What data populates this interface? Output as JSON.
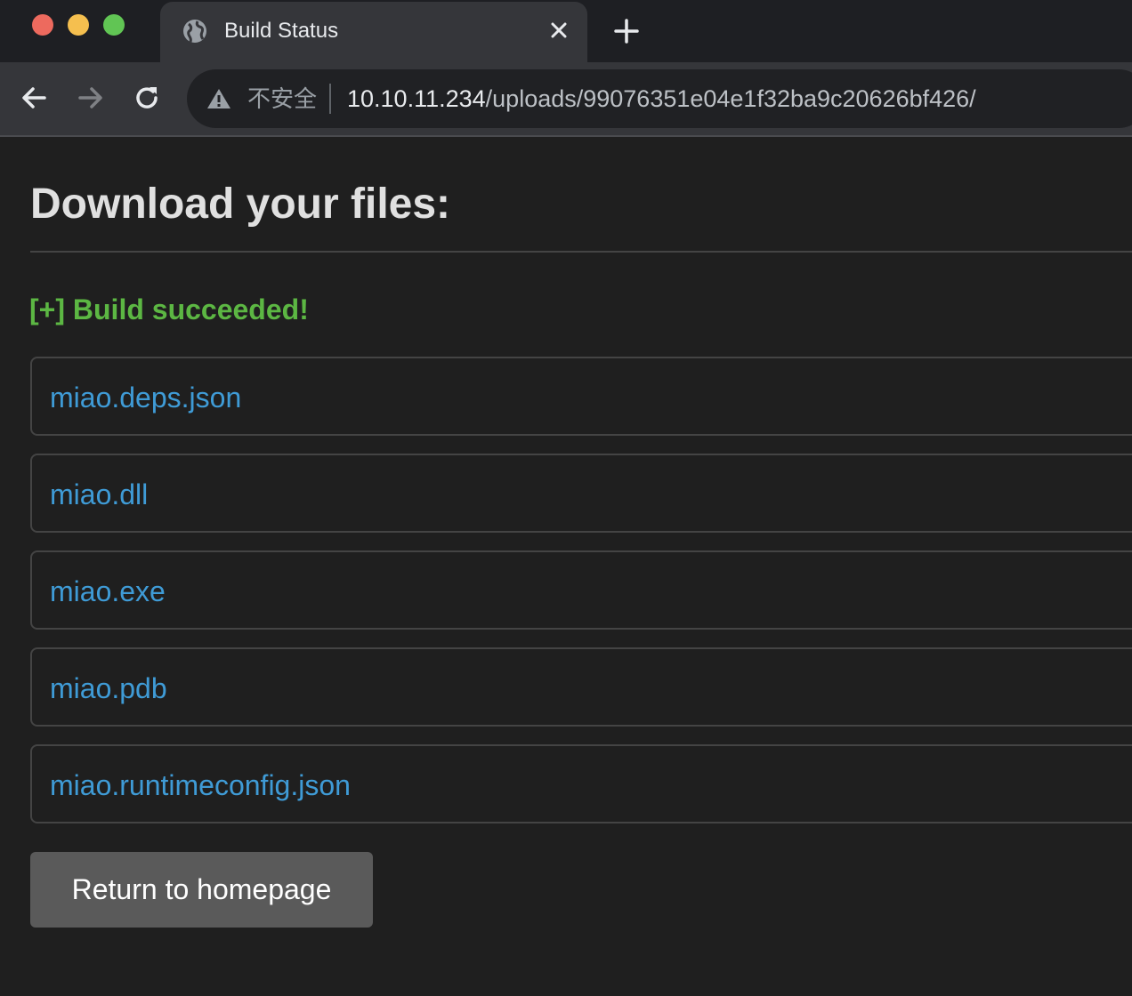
{
  "browser": {
    "tab": {
      "title": "Build Status"
    },
    "address_bar": {
      "security_label": "不安全",
      "host": "10.10.11.234",
      "path": "/uploads/99076351e04e1f32ba9c20626bf426/"
    },
    "icons": [
      "globe-icon",
      "close-icon",
      "new-tab-icon",
      "back-icon",
      "forward-icon",
      "reload-icon",
      "warning-icon"
    ]
  },
  "page": {
    "heading": "Download your files:",
    "status": "[+] Build succeeded!",
    "files": [
      {
        "name": "miao.deps.json"
      },
      {
        "name": "miao.dll"
      },
      {
        "name": "miao.exe"
      },
      {
        "name": "miao.pdb"
      },
      {
        "name": "miao.runtimeconfig.json"
      }
    ],
    "return_button": "Return to homepage"
  },
  "colors": {
    "background": "#1f1f1f",
    "status_green": "#5cb743",
    "link_blue": "#3f9bd6",
    "button_gray": "#5a5a5a"
  }
}
